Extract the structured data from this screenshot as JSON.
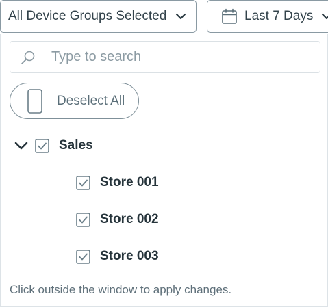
{
  "filters": {
    "group_select_label": "All Device Groups Selected",
    "date_range_label": "Last 7 Days"
  },
  "search": {
    "placeholder": "Type to search",
    "value": ""
  },
  "deselect_all_label": "Deselect All",
  "tree": {
    "root": {
      "label": "Sales",
      "checked": true,
      "expanded": true
    },
    "children": [
      {
        "label": "Store 001",
        "checked": true
      },
      {
        "label": "Store 002",
        "checked": true
      },
      {
        "label": "Store 003",
        "checked": true
      }
    ]
  },
  "footer_hint": "Click outside the window to apply changes.",
  "colors": {
    "text": "#26343b",
    "border": "#8a9aa3",
    "checkbox": "#6b7f89",
    "muted": "#8c9ba3"
  }
}
